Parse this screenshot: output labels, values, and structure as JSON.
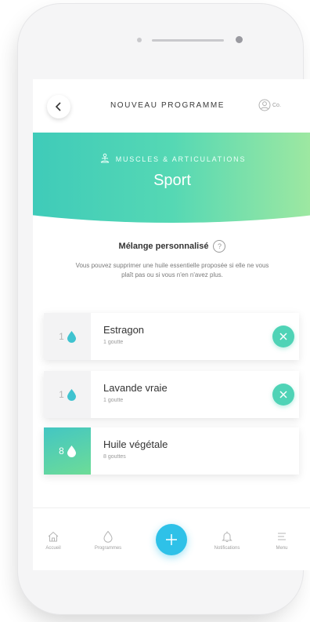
{
  "header": {
    "title": "NOUVEAU PROGRAMME",
    "user_label": "Co."
  },
  "hero": {
    "category": "MUSCLES & ARTICULATIONS",
    "title": "Sport"
  },
  "mix": {
    "title": "Mélange personnalisé",
    "help": "?",
    "description": "Vous pouvez supprimer une huile essentielle proposée si elle ne vous plaît pas ou si vous n'en n'avez plus."
  },
  "oils": [
    {
      "qty": "1",
      "name": "Estragon",
      "unit": "1 goutte"
    },
    {
      "qty": "1",
      "name": "Lavande vraie",
      "unit": "1 goutte"
    }
  ],
  "vegetable_oil": {
    "qty": "8",
    "name": "Huile végétale",
    "unit": "8 gouttes"
  },
  "tabs": [
    {
      "label": "Accueil",
      "icon": "home-icon"
    },
    {
      "label": "Programmes",
      "icon": "drop-icon"
    },
    {
      "label": "Notifications",
      "icon": "bell-icon"
    },
    {
      "label": "Menu",
      "icon": "menu-icon"
    }
  ],
  "colors": {
    "accent": "#4fd3b6",
    "fab": "#2ec1e8",
    "drop": "#3fc3d0"
  }
}
